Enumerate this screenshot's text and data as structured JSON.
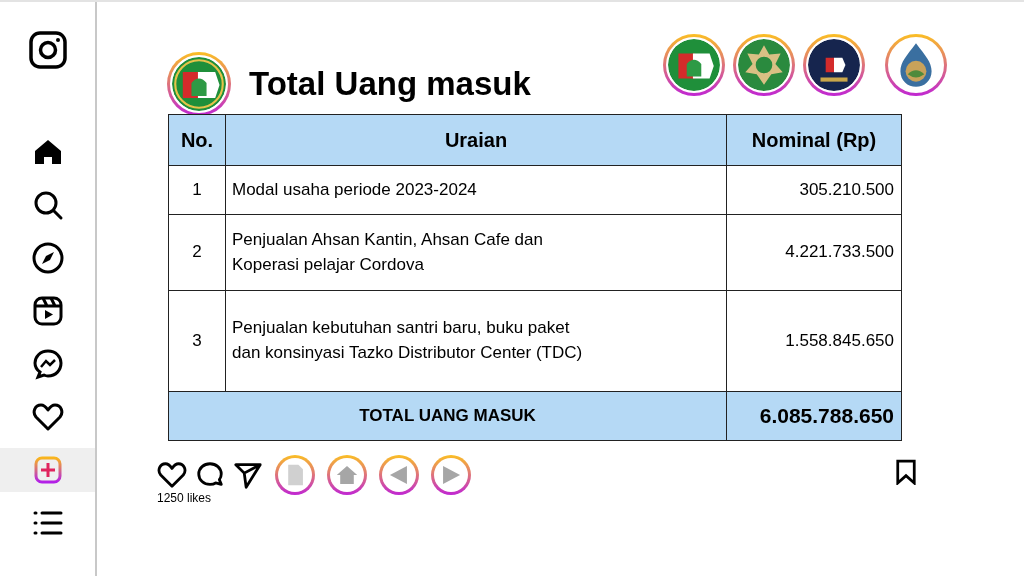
{
  "sidebar": {
    "items": [
      {
        "kind": "home",
        "selected": false
      },
      {
        "kind": "search",
        "selected": false
      },
      {
        "kind": "explore",
        "selected": false
      },
      {
        "kind": "reels",
        "selected": false
      },
      {
        "kind": "messages",
        "selected": false
      },
      {
        "kind": "notifications",
        "selected": false
      },
      {
        "kind": "create",
        "selected": true
      },
      {
        "kind": "more",
        "selected": false
      }
    ]
  },
  "post": {
    "title": "Total Uang masuk"
  },
  "table": {
    "columns": [
      "No.",
      "Uraian",
      "Nominal (Rp)"
    ],
    "rows": [
      {
        "no": "1",
        "lines": [
          "Modal usaha periode 2023-2024"
        ],
        "nominal": "305.210.500"
      },
      {
        "no": "2",
        "lines": [
          "Penjualan Ahsan Kantin, Ahsan Cafe dan",
          "Koperasi pelajar Cordova"
        ],
        "nominal": "4.221.733.500"
      },
      {
        "no": "3",
        "lines": [
          "Penjualan kebutuhan santri baru, buku paket",
          "dan konsinyasi Tazko Distributor Center (TDC)"
        ],
        "nominal": "1.558.845.650"
      }
    ],
    "total": {
      "label": "TOTAL UANG MASUK",
      "nominal": "6.085.788.650"
    }
  },
  "actions": [
    {
      "kind": "like"
    },
    {
      "kind": "comment"
    },
    {
      "kind": "share"
    }
  ],
  "nav_buttons": [
    {
      "kind": "document"
    },
    {
      "kind": "home"
    },
    {
      "kind": "previous"
    },
    {
      "kind": "next"
    }
  ],
  "likes": "1250 likes"
}
